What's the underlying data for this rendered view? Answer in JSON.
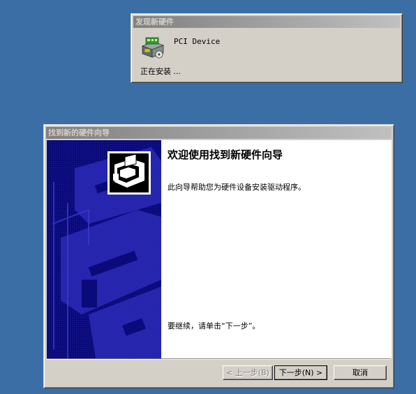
{
  "notification": {
    "title": "发现新硬件",
    "device_name": "PCI Device",
    "status": "正在安装 ..."
  },
  "wizard": {
    "title": "找到新的硬件向导",
    "heading": "欢迎使用找到新硬件向导",
    "description": "此向导帮助您为硬件设备安装驱动程序。",
    "continue_hint": "要继续，请单击“下一步”。",
    "buttons": {
      "back": "< 上一步(B)",
      "next": "下一步(N) >",
      "cancel": "取消"
    }
  },
  "colors": {
    "desktop": "#3a6ea5",
    "window_face": "#d4d0c8",
    "inactive_title_start": "#808080",
    "inactive_title_end": "#c0c0c0",
    "banner": "#0a0a7a"
  },
  "icons": {
    "device": "hardware-device-icon",
    "wizard": "hardware-wizard-icon"
  }
}
